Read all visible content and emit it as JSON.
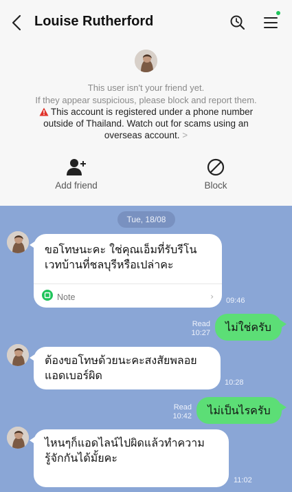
{
  "header": {
    "title": "Louise Rutherford",
    "back_icon": "back-chevron-icon",
    "search_icon": "search-icon",
    "menu_icon": "menu-icon",
    "notification_color": "#1fc45b"
  },
  "warning": {
    "line1": "This user isn't your friend yet.",
    "line2": "If they appear suspicious, please block and report them.",
    "line3": "This account is registered under a phone number outside of Thailand. Watch out for scams using an overseas account.",
    "line3_chevron": ">",
    "warning_color": "#e0332a"
  },
  "actions": {
    "add_friend_label": "Add friend",
    "block_label": "Block"
  },
  "chat": {
    "date": "Tue, 18/08",
    "background_color": "#8aa6d6",
    "outgoing_color": "#5cde76",
    "messages": [
      {
        "direction": "in",
        "text": "ขอโทษนะคะ ใช่คุณเอ็มที่รับรีโนเวทบ้านที่ชลบุรีหรือเปล่าคะ",
        "note_label": "Note",
        "time": "09:46"
      },
      {
        "direction": "out",
        "text": "ไม่ใช่ครับ",
        "read": "Read",
        "time": "10:27"
      },
      {
        "direction": "in",
        "text": "ต้องขอโทษด้วยนะคะสงสัยพลอยแอดเบอร์ผิด",
        "time": "10:28"
      },
      {
        "direction": "out",
        "text": "ไม่เป็นไรครับ",
        "read": "Read",
        "time": "10:42"
      },
      {
        "direction": "in",
        "text": "ไหนๆก็แอดไลน์ไปผิดแล้วทำความรู้จักกันได้มั้ยคะ",
        "time": "11:02"
      }
    ]
  }
}
